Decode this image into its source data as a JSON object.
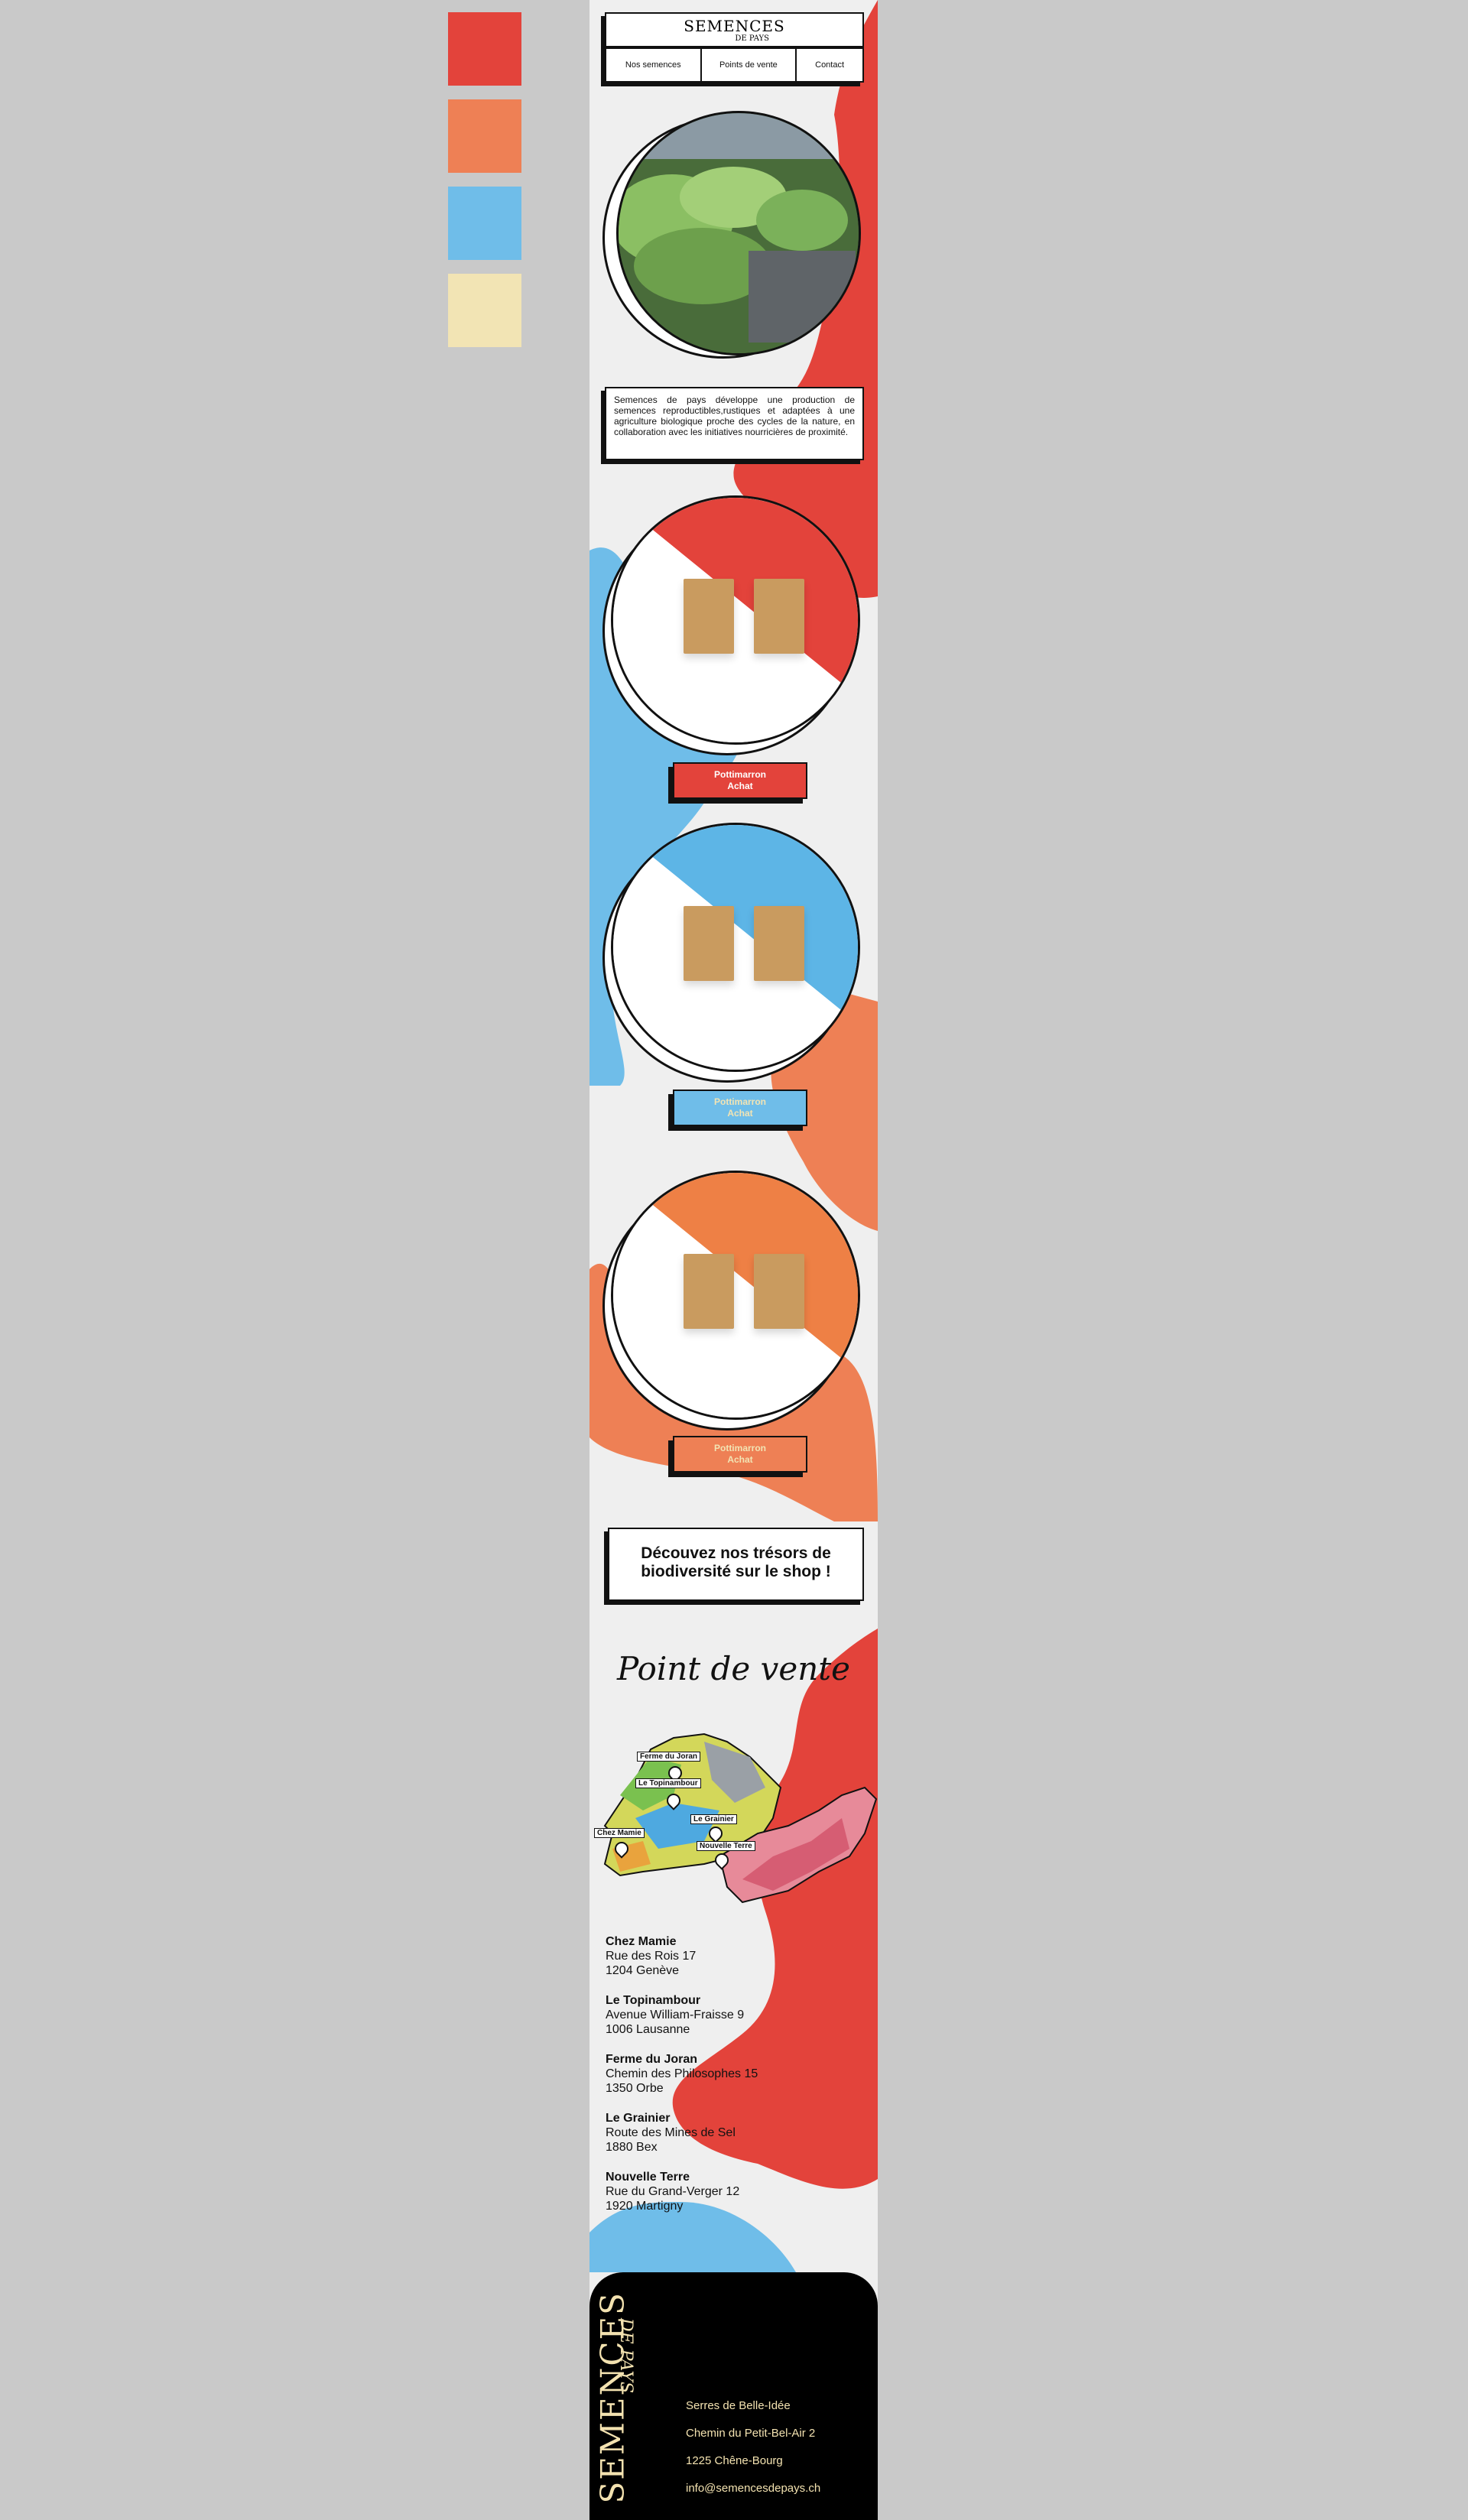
{
  "palette": {
    "red": "#e3433b",
    "orange": "#ee8055",
    "blue": "#6fbde9",
    "cream": "#f2e4b4"
  },
  "header": {
    "logo_main": "SEMENCES",
    "logo_sub": "DE PAYS",
    "nav": [
      "Nos semences",
      "Points de vente",
      "Contact"
    ]
  },
  "intro": {
    "text": "Semences de pays développe une production de semences reproductibles,rustiques et adaptées à une agriculture biologique proche des cycles de la nature, en collaboration avec les initiatives nourricières de proximité."
  },
  "products": [
    {
      "name": "Pottimarron",
      "action": "Achat",
      "color": "#e3433b"
    },
    {
      "name": "Pottimarron",
      "action": "Achat",
      "color": "#6fbde9"
    },
    {
      "name": "Pottimarron",
      "action": "Achat",
      "color": "#ee8055"
    }
  ],
  "shop_banner": {
    "line1": "Découvez nos trésors de",
    "line2": "biodiversité sur le shop !"
  },
  "sales_points": {
    "title": "Point de vente",
    "map_labels": [
      "Ferme du Joran",
      "Le Topinambour",
      "Le Grainier",
      "Chez Mamie",
      "Nouvelle Terre"
    ],
    "stores": [
      {
        "name": "Chez Mamie",
        "street": "Rue des Rois 17",
        "city": "1204 Genève"
      },
      {
        "name": "Le Topinambour",
        "street": "Avenue William-Fraisse 9",
        "city": "1006 Lausanne"
      },
      {
        "name": "Ferme du Joran",
        "street": "Chemin des Philosophes 15",
        "city": "1350 Orbe"
      },
      {
        "name": "Le Grainier",
        "street": "Route des Mines de Sel",
        "city": "1880 Bex"
      },
      {
        "name": "Nouvelle Terre",
        "street": "Rue du Grand-Verger 12",
        "city": "1920 Martigny"
      }
    ]
  },
  "footer": {
    "logo_main": "SEMENCES",
    "logo_sub": "DE PAYS",
    "lines": [
      "Serres de Belle-Idée",
      "Chemin du Petit-Bel-Air 2",
      "1225 Chêne-Bourg",
      "info@semencesdepays.ch"
    ]
  }
}
